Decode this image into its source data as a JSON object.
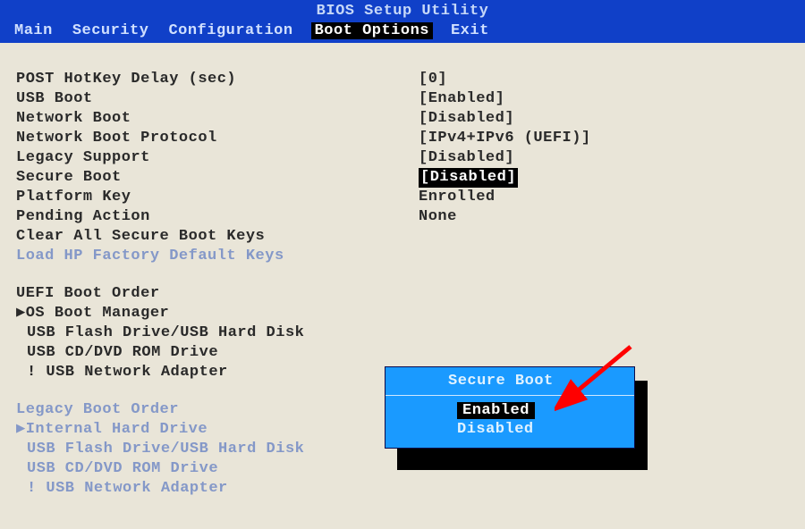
{
  "header": {
    "utility_title": "BIOS Setup Utility",
    "tabs": [
      "Main",
      "Security",
      "Configuration",
      "Boot Options",
      "Exit"
    ],
    "active_tab": "Boot Options"
  },
  "settings": [
    {
      "label": "POST HotKey Delay (sec)",
      "value": "[0]",
      "interact": true
    },
    {
      "label": "USB Boot",
      "value": "[Enabled]",
      "interact": true
    },
    {
      "label": "Network Boot",
      "value": "[Disabled]",
      "interact": true
    },
    {
      "label": "Network Boot Protocol",
      "value": "[IPv4+IPv6 (UEFI)]",
      "interact": true
    },
    {
      "label": "Legacy Support",
      "value": "[Disabled]",
      "interact": true
    },
    {
      "label": "Secure Boot",
      "value": "[Disabled]",
      "interact": true,
      "selected": true
    },
    {
      "label": "Platform Key",
      "value": "Enrolled",
      "interact": false
    },
    {
      "label": "Pending Action",
      "value": "None",
      "interact": false
    },
    {
      "label": "Clear All Secure Boot Keys",
      "value": "",
      "interact": true
    },
    {
      "label": "Load HP Factory Default Keys",
      "value": "",
      "interact": false,
      "disabled": true
    }
  ],
  "uefi_boot": {
    "heading": "UEFI Boot Order",
    "items": [
      {
        "label": "▶OS Boot Manager",
        "indent": ""
      },
      {
        "label": "USB Flash Drive/USB Hard Disk",
        "indent": " "
      },
      {
        "label": "USB CD/DVD ROM Drive",
        "indent": " "
      },
      {
        "label": "! USB Network Adapter",
        "indent": " "
      }
    ]
  },
  "legacy_boot": {
    "heading": "Legacy Boot Order",
    "items": [
      {
        "label": "▶Internal Hard Drive",
        "indent": ""
      },
      {
        "label": "USB Flash Drive/USB Hard Disk",
        "indent": " "
      },
      {
        "label": "USB CD/DVD ROM Drive",
        "indent": " "
      },
      {
        "label": "! USB Network Adapter",
        "indent": " "
      }
    ]
  },
  "popup": {
    "title": "Secure Boot",
    "options": [
      "Enabled",
      "Disabled"
    ],
    "selected": "Enabled"
  }
}
